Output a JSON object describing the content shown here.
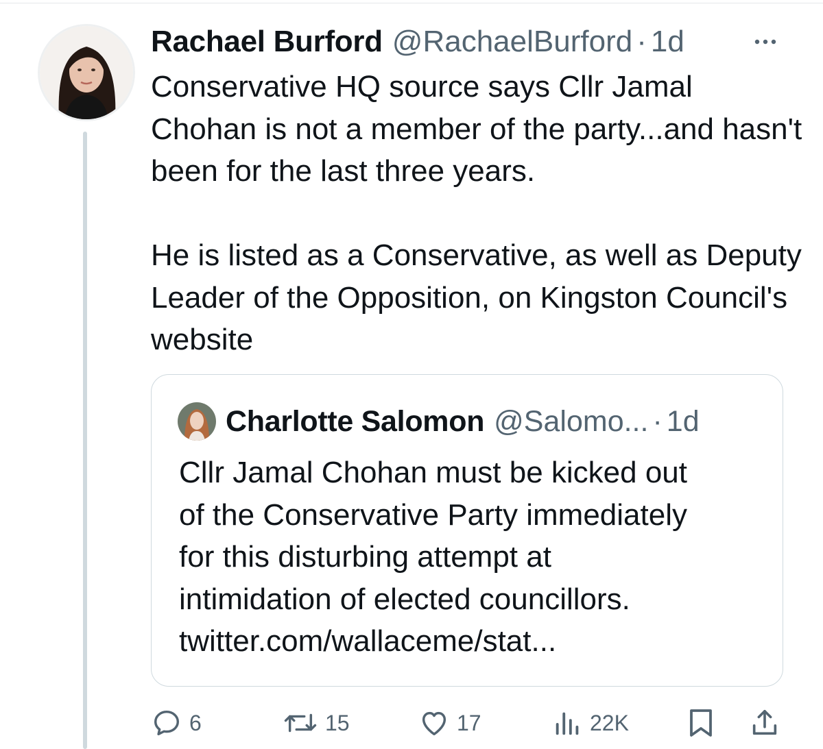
{
  "tweet": {
    "author_name": "Rachael Burford",
    "author_handle": "@RachaelBurford",
    "separator": "·",
    "timestamp": "1d",
    "paragraph_1": "Conservative HQ source says Cllr Jamal Chohan is not a member of the party...and hasn't been for the last three years.",
    "paragraph_2": "He is listed as a Conservative, as well as Deputy Leader of the Opposition, on Kingston Council's website"
  },
  "quote": {
    "author_name": "Charlotte Salomon",
    "author_handle": "@Salomo...",
    "separator": "·",
    "timestamp": "1d",
    "lines": [
      "Cllr Jamal Chohan must be kicked out",
      "of the Conservative Party immediately",
      "for this disturbing attempt at",
      "intimidation of elected councillors.",
      "twitter.com/wallaceme/stat..."
    ]
  },
  "actions": {
    "replies": "6",
    "reposts": "15",
    "likes": "17",
    "views": "22K"
  },
  "colors": {
    "text_primary": "#0f1419",
    "text_secondary": "#536471",
    "border": "#cfd9de",
    "thread_line": "#cfd9de"
  },
  "icons": {
    "more": "more-icon",
    "reply": "reply-icon",
    "repost": "repost-icon",
    "like": "like-icon",
    "views": "views-icon",
    "bookmark": "bookmark-icon",
    "share": "share-icon"
  }
}
